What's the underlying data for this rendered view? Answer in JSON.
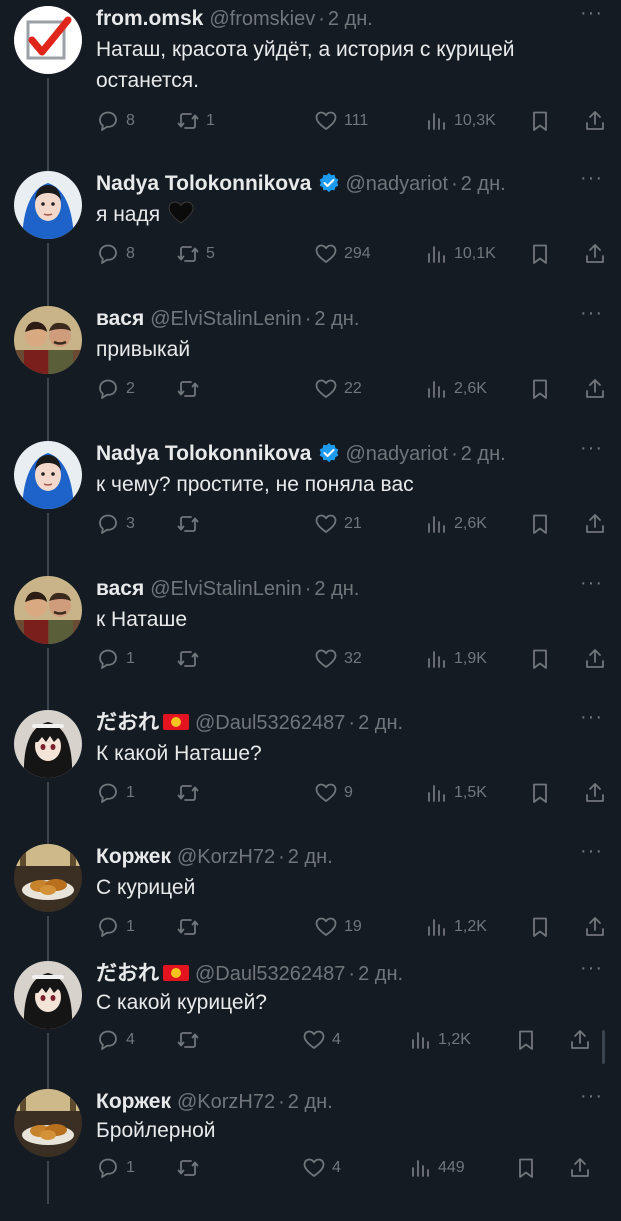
{
  "tweets": [
    {
      "name": "from.omsk",
      "handle": "@fromskiev",
      "time": "2 дн.",
      "text": "Наташ, красота уйдёт, а история с курицей останется.",
      "replies": "8",
      "reposts": "1",
      "likes": "111",
      "views": "10,3K",
      "avatar": "checkmark-logo"
    },
    {
      "name": "Nadya Tolokonnikova",
      "handle": "@nadyariot",
      "time": "2 дн.",
      "verified": true,
      "text": "я надя",
      "emoji": "black-heart",
      "replies": "8",
      "reposts": "5",
      "likes": "294",
      "views": "10,1K",
      "avatar": "woman-blue-headscarf"
    },
    {
      "name": "вася",
      "handle": "@ElviStalinLenin",
      "time": "2 дн.",
      "text": "привыкай",
      "replies": "2",
      "reposts": "",
      "likes": "22",
      "views": "2,6K",
      "avatar": "two-portraits"
    },
    {
      "name": "Nadya Tolokonnikova",
      "handle": "@nadyariot",
      "time": "2 дн.",
      "verified": true,
      "text": "к чему? простите, не поняла вас",
      "replies": "3",
      "reposts": "",
      "likes": "21",
      "views": "2,6K",
      "avatar": "woman-blue-headscarf"
    },
    {
      "name": "вася",
      "handle": "@ElviStalinLenin",
      "time": "2 дн.",
      "text": "к Наташе",
      "replies": "1",
      "reposts": "",
      "likes": "32",
      "views": "1,9K",
      "avatar": "two-portraits"
    },
    {
      "name": "だおれ",
      "handle": "@Daul53262487",
      "time": "2 дн.",
      "flag": "kyrgyzstan-flag",
      "text": "К какой Наташе?",
      "replies": "1",
      "reposts": "",
      "likes": "9",
      "views": "1,5K",
      "avatar": "anime-girl"
    },
    {
      "name": "Коржек",
      "handle": "@KorzH72",
      "time": "2 дн.",
      "text": "С курицей",
      "replies": "1",
      "reposts": "",
      "likes": "19",
      "views": "1,2K",
      "avatar": "chicken-dish"
    },
    {
      "name": "だおれ",
      "handle": "@Daul53262487",
      "time": "2 дн.",
      "flag": "kyrgyzstan-flag",
      "text": "С какой курицей?",
      "replies": "4",
      "reposts": "",
      "likes": "4",
      "views": "1,2K",
      "avatar": "anime-girl"
    },
    {
      "name": "Коржек",
      "handle": "@KorzH72",
      "time": "2 дн.",
      "text": "Бройлерной",
      "replies": "1",
      "reposts": "",
      "likes": "4",
      "views": "449",
      "avatar": "chicken-dish"
    }
  ],
  "ui": {
    "separator_dot": "·",
    "more_label": "···"
  },
  "colors": {
    "background": "#151b23",
    "text": "#e7e9ea",
    "muted": "#71767b",
    "verified": "#1d9bf0",
    "thread_line": "#3a4550"
  }
}
